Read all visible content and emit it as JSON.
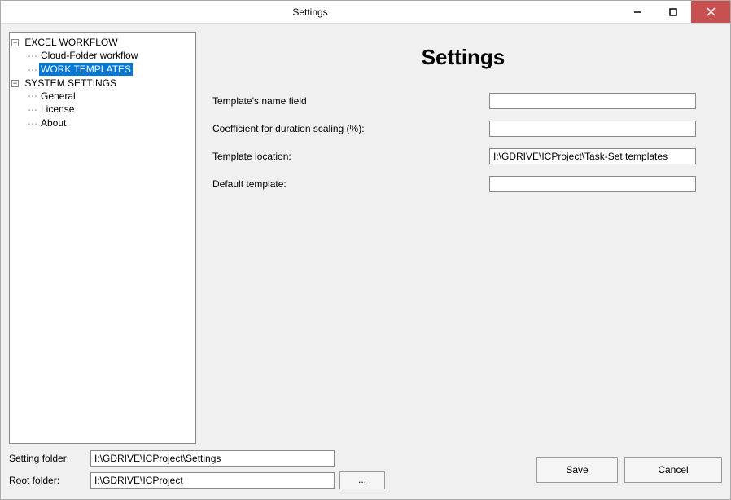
{
  "window": {
    "title": "Settings"
  },
  "tree": {
    "groups": [
      {
        "label": "EXCEL WORKFLOW",
        "items": [
          {
            "label": "Cloud-Folder workflow",
            "selected": false
          },
          {
            "label": "WORK TEMPLATES",
            "selected": true
          }
        ]
      },
      {
        "label": "SYSTEM SETTINGS",
        "items": [
          {
            "label": "General",
            "selected": false
          },
          {
            "label": "License",
            "selected": false
          },
          {
            "label": "About",
            "selected": false
          }
        ]
      }
    ]
  },
  "panel": {
    "heading": "Settings",
    "fields": {
      "template_name": {
        "label": "Template's name field",
        "value": ""
      },
      "coefficient": {
        "label": "Coefficient for duration scaling (%):",
        "value": ""
      },
      "template_location": {
        "label": "Template location:",
        "value": "I:\\GDRIVE\\ICProject\\Task-Set templates"
      },
      "default_template": {
        "label": "Default template:",
        "value": ""
      }
    }
  },
  "footer": {
    "setting_folder": {
      "label": "Setting folder:",
      "value": "I:\\GDRIVE\\ICProject\\Settings"
    },
    "root_folder": {
      "label": "Root folder:",
      "value": "I:\\GDRIVE\\ICProject"
    },
    "browse": "...",
    "save": "Save",
    "cancel": "Cancel"
  }
}
